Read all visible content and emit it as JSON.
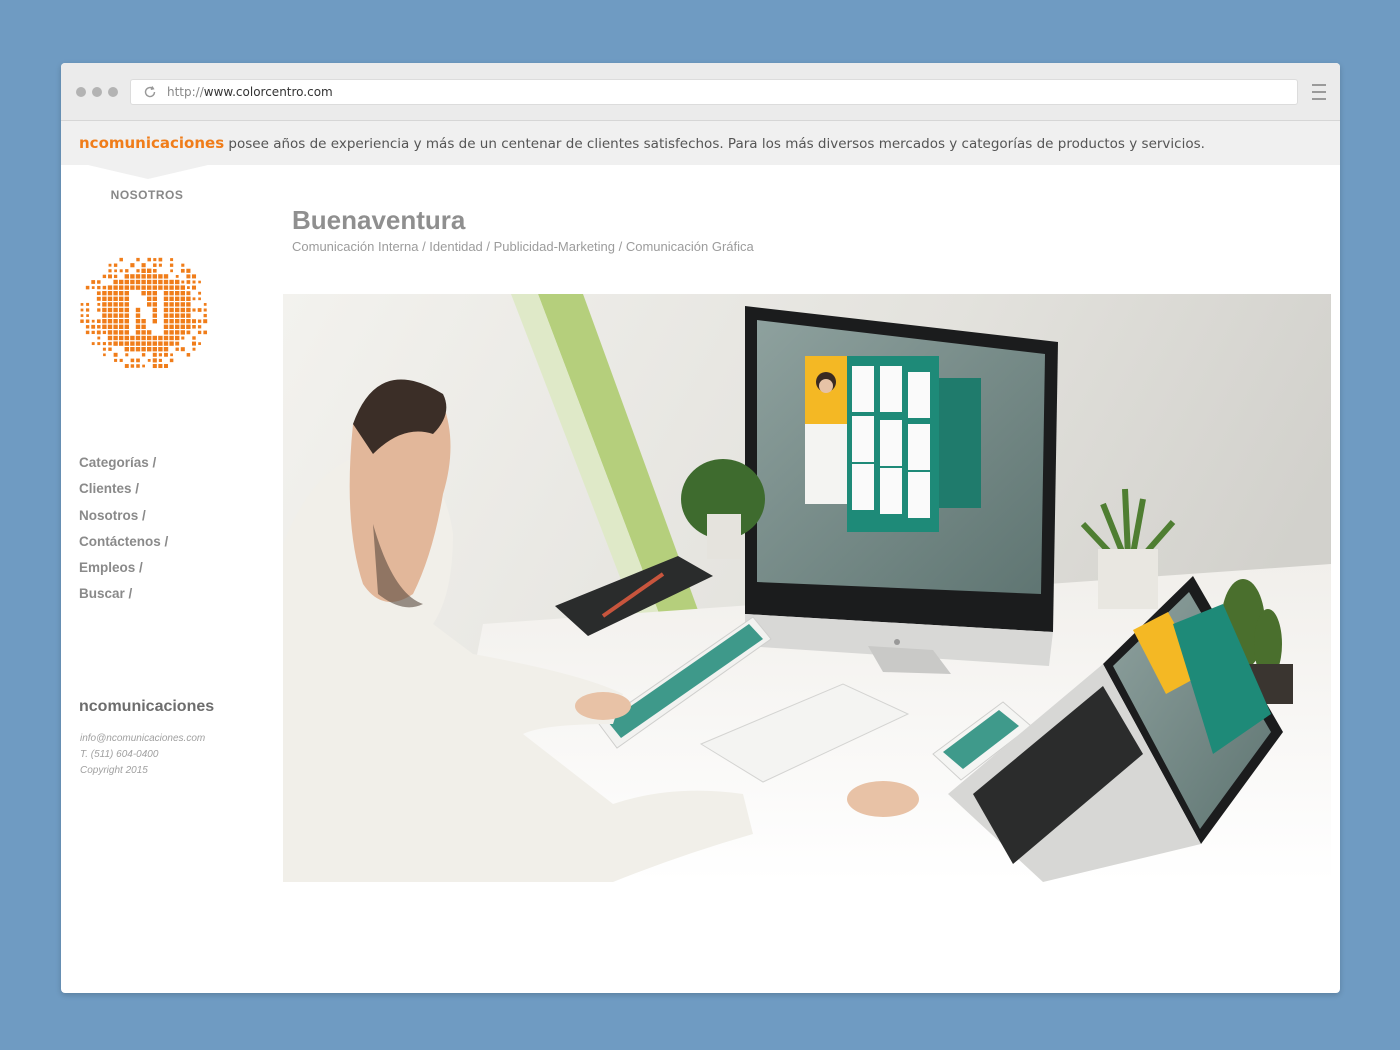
{
  "browser": {
    "url_protocol": "http://",
    "url_domain": "www.colorcentro.com"
  },
  "banner": {
    "brand": "ncomunicaciones",
    "text": " posee años de experiencia y más de un centenar de clientes satisfechos. Para los más diversos mercados y categorías de productos y servicios."
  },
  "section_tab": "NOSOTROS",
  "nav": [
    "Categorías /",
    "Clientes /",
    "Nosotros /",
    "Contáctenos /",
    "Empleos /",
    "Buscar /"
  ],
  "footer": {
    "brand": "ncomunicaciones",
    "email": "info@ncomunicaciones.com",
    "phone": "T. (511) 604-0400",
    "copyright": "Copyright 2015"
  },
  "project": {
    "title": "Buenaventura",
    "categories": "Comunicación Interna / Identidad / Publicidad-Marketing / Comunicación Gráfica"
  },
  "colors": {
    "brand_orange": "#f07d1a",
    "app_teal": "#1e8a78",
    "app_yellow": "#f4b824",
    "page_background": "#6f9bc2"
  }
}
